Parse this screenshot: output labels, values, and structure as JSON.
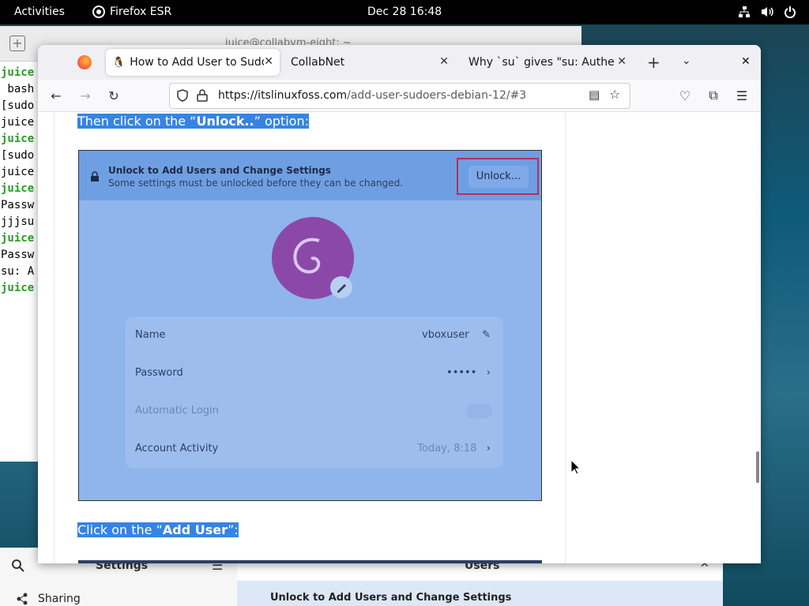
{
  "topbar": {
    "activities": "Activities",
    "app_name": "Firefox ESR",
    "clock": "Dec 28  16:48"
  },
  "terminal": {
    "title": "juice@collabvm-eight: ~",
    "lines": [
      {
        "text": "juice",
        "green": true
      },
      {
        "text": " bash",
        "green": false
      },
      {
        "text": "[sudo",
        "green": false
      },
      {
        "text": "juice",
        "green": false
      },
      {
        "text": "juice",
        "green": true
      },
      {
        "text": "[sudo",
        "green": false
      },
      {
        "text": "juice",
        "green": false
      },
      {
        "text": "juice",
        "green": true
      },
      {
        "text": "Passw",
        "green": false
      },
      {
        "text": "jjjsu",
        "green": false
      },
      {
        "text": "juice",
        "green": true
      },
      {
        "text": "Passw",
        "green": false
      },
      {
        "text": "su: A",
        "green": false
      },
      {
        "text": "juice",
        "green": true
      }
    ]
  },
  "settings": {
    "search_title": "Settings",
    "sidebar_item": "Sharing",
    "header": "Users",
    "banner": "Unlock to Add Users and Change Settings"
  },
  "browser": {
    "tabs": [
      {
        "label": "How to Add User to Sudo",
        "active": true
      },
      {
        "label": "CollabNet",
        "active": false
      },
      {
        "label": "Why `su` gives \"su: Authenti",
        "active": false
      }
    ],
    "url_host": "https://itslinuxfoss.com",
    "url_path": "/add-user-sudoers-debian-12/#3"
  },
  "article": {
    "para1_pre": "Then click on the “",
    "para1_bold": "Unlock..",
    "para1_post": "” option:",
    "para2_pre": "Click on the “",
    "para2_bold": "Add User",
    "para2_post": "”:",
    "screenshot": {
      "header_title": "Unlock to Add Users and Change Settings",
      "header_sub": "Some settings must be unlocked before they can be changed.",
      "unlock_label": "Unlock...",
      "rows": [
        {
          "label": "Name",
          "value": "vboxuser"
        },
        {
          "label": "Password",
          "value": "•••••"
        },
        {
          "label": "Automatic Login",
          "value": ""
        },
        {
          "label": "Account Activity",
          "value": "Today,    8:18"
        }
      ]
    }
  }
}
